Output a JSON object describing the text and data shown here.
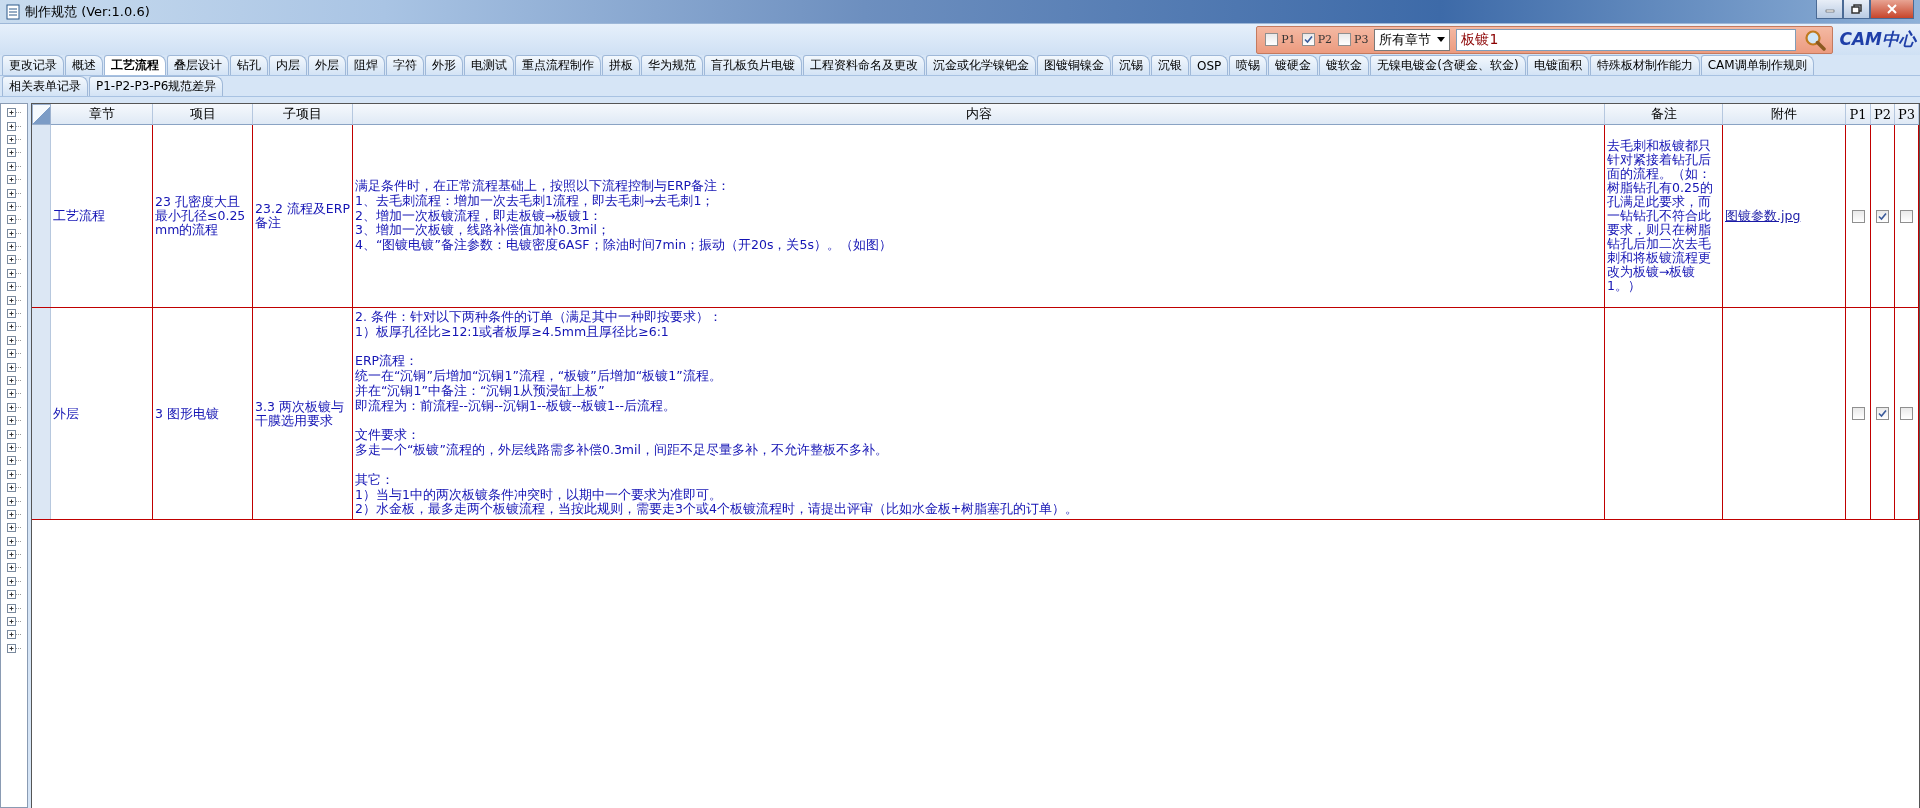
{
  "window": {
    "title": "制作规范 (Ver:1.0.6)"
  },
  "filter": {
    "levels": [
      {
        "label": "P1",
        "checked": false
      },
      {
        "label": "P2",
        "checked": true
      },
      {
        "label": "P3",
        "checked": false
      }
    ],
    "chapter_select": "所有章节",
    "search": {
      "value": "板镀1"
    },
    "logo": "CAM中心"
  },
  "tab_rows": [
    [
      {
        "label": "更改记录",
        "selected": false
      },
      {
        "label": "概述",
        "selected": false
      },
      {
        "label": "工艺流程",
        "selected": true
      },
      {
        "label": "叠层设计",
        "selected": false
      },
      {
        "label": "钻孔",
        "selected": false
      },
      {
        "label": "内层",
        "selected": false
      },
      {
        "label": "外层",
        "selected": false
      },
      {
        "label": "阻焊",
        "selected": false
      },
      {
        "label": "字符",
        "selected": false
      },
      {
        "label": "外形",
        "selected": false
      },
      {
        "label": "电测试",
        "selected": false
      },
      {
        "label": "重点流程制作",
        "selected": false
      },
      {
        "label": "拼板",
        "selected": false
      },
      {
        "label": "华为规范",
        "selected": false
      },
      {
        "label": "盲孔板负片电镀",
        "selected": false
      },
      {
        "label": "工程资料命名及更改",
        "selected": false
      },
      {
        "label": "沉金或化学镍钯金",
        "selected": false
      },
      {
        "label": "图镀铜镍金",
        "selected": false
      },
      {
        "label": "沉锡",
        "selected": false
      },
      {
        "label": "沉银",
        "selected": false
      },
      {
        "label": "OSP",
        "selected": false
      },
      {
        "label": "喷锡",
        "selected": false
      },
      {
        "label": "镀硬金",
        "selected": false
      },
      {
        "label": "镀软金",
        "selected": false
      },
      {
        "label": "无镍电镀金(含硬金、软金)",
        "selected": false
      },
      {
        "label": "电镀面积",
        "selected": false
      },
      {
        "label": "特殊板材制作能力",
        "selected": false
      },
      {
        "label": "CAM调单制作规则",
        "selected": false
      }
    ],
    [
      {
        "label": "相关表单记录",
        "selected": false
      },
      {
        "label": "P1-P2-P3-P6规范差异",
        "selected": false
      }
    ]
  ],
  "tree_nodes": [
    {
      "expanded": false
    },
    {
      "expanded": false
    },
    {
      "expanded": false
    },
    {
      "expanded": false
    },
    {
      "expanded": false
    },
    {
      "expanded": false
    },
    {
      "expanded": false
    },
    {
      "expanded": false
    },
    {
      "expanded": false
    },
    {
      "expanded": false
    },
    {
      "expanded": false
    },
    {
      "expanded": false
    },
    {
      "expanded": false
    },
    {
      "expanded": false
    },
    {
      "expanded": false
    },
    {
      "expanded": false
    },
    {
      "expanded": false
    },
    {
      "expanded": false
    },
    {
      "expanded": false
    },
    {
      "expanded": false
    },
    {
      "expanded": false
    },
    {
      "expanded": false
    },
    {
      "expanded": false
    },
    {
      "expanded": false
    },
    {
      "expanded": false
    },
    {
      "expanded": false
    },
    {
      "expanded": false
    },
    {
      "expanded": false
    },
    {
      "expanded": false
    },
    {
      "expanded": false
    },
    {
      "expanded": false
    },
    {
      "expanded": false
    },
    {
      "expanded": false
    },
    {
      "expanded": false
    },
    {
      "expanded": false
    },
    {
      "expanded": false
    },
    {
      "expanded": false
    },
    {
      "expanded": false
    },
    {
      "expanded": false
    },
    {
      "expanded": false
    },
    {
      "expanded": false
    }
  ],
  "table": {
    "columns": [
      "章节",
      "项目",
      "子项目",
      "内容",
      "备注",
      "附件",
      "P1",
      "P2",
      "P3"
    ],
    "rows": [
      {
        "chapter": "工艺流程",
        "item": "23 孔密度大且最小孔径≤0.25mm的流程",
        "subitem": "23.2 流程及ERP备注",
        "content": [
          [
            "满足条件时，在正常流程基础上，按照以下流程控制与ERP备注：",
            "1、去毛刺流程：增加一次去毛刺1流程，即去毛刺→去毛刺1；",
            "2、增加一次板镀流程，即走板镀→板镀1：",
            "3、增加一次板镀，线路补偿值加补0.3mil；",
            "4、“图镀电镀”备注参数：电镀密度6ASF；除油时间7min；振动（开20s，关5s）。（如图）"
          ]
        ],
        "remark": "去毛刺和板镀都只针对紧接着钻孔后面的流程。（如：树脂钻孔有0.25的孔满足此要求，而一钻钻孔不符合此要求，则只在树脂钻孔后加二次去毛刺和将板镀流程更改为板镀→板镀1。）",
        "attachment": "图镀参数.jpg",
        "levels": [
          {
            "checked": false
          },
          {
            "checked": true
          },
          {
            "checked": false
          }
        ]
      },
      {
        "chapter": "外层",
        "item": "3 图形电镀",
        "subitem": "3.3 两次板镀与干膜选用要求",
        "content": [
          [
            "2. 条件：针对以下两种条件的订单（满足其中一种即按要求）：",
            "1）板厚孔径比≥12:1或者板厚≥4.5mm且厚径比≥6:1"
          ],
          [
            "ERP流程：",
            "统一在“沉铜”后增加“沉铜1”流程，“板镀”后增加“板镀1”流程。",
            "并在“沉铜1”中备注：“沉铜1从预浸缸上板”",
            "即流程为：前流程--沉铜--沉铜1--板镀--板镀1--后流程。"
          ],
          [
            "文件要求：",
            "多走一个“板镀”流程的，外层线路需多补偿0.3mil，间距不足尽量多补，不允许整板不多补。"
          ],
          [
            "其它：",
            "1）当与1中的两次板镀条件冲突时，以期中一个要求为准即可。",
            "2）水金板，最多走两个板镀流程，当按此规则，需要走3个或4个板镀流程时，请提出评审（比如水金板+树脂塞孔的订单）。"
          ]
        ],
        "remark": "",
        "attachment": "",
        "levels": [
          {
            "checked": false
          },
          {
            "checked": true
          },
          {
            "checked": false
          }
        ]
      }
    ]
  }
}
